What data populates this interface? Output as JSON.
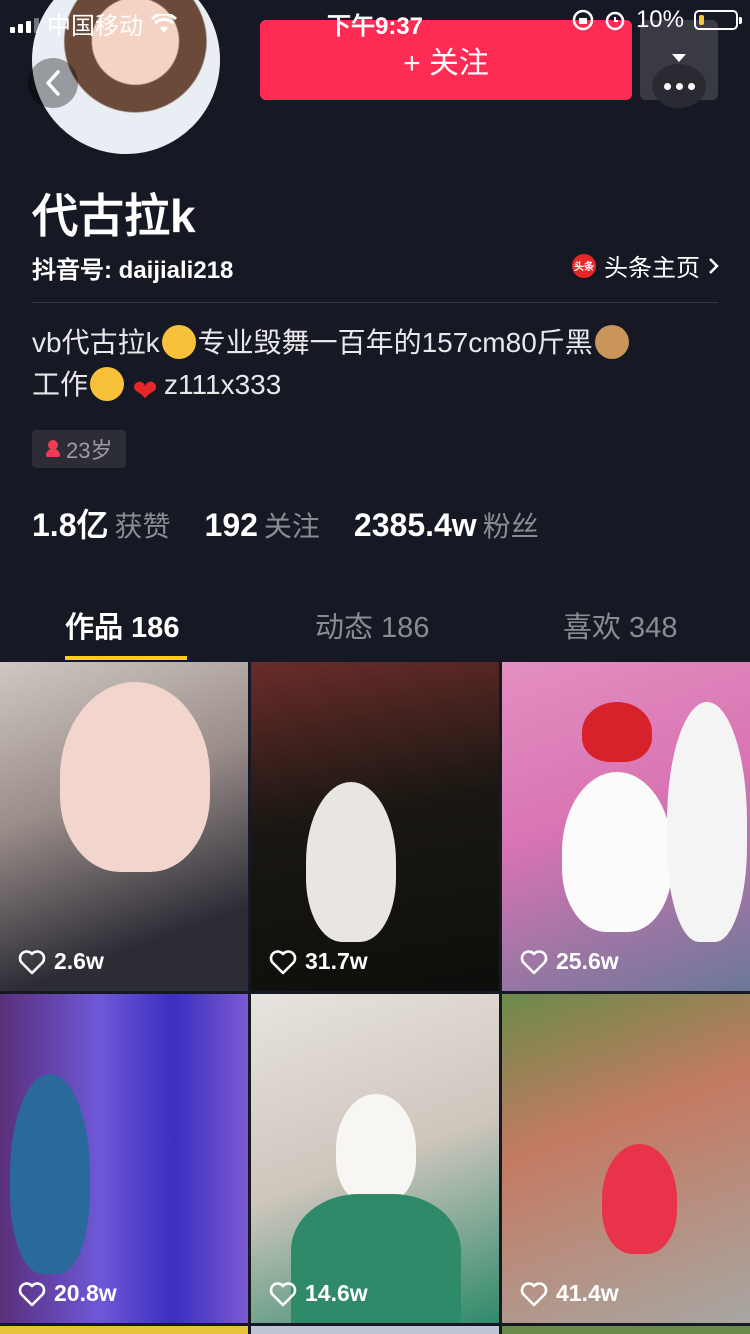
{
  "status_bar": {
    "carrier": "中国移动",
    "time": "下午9:37",
    "battery": "10%"
  },
  "header": {
    "follow_label": "+ 关注"
  },
  "profile": {
    "name": "代古拉k",
    "douyin_id": "抖音号: daijiali218",
    "toutiao_label": "头条主页",
    "toutiao_logo": "头条",
    "bio_part1": "vb代古拉k",
    "bio_part2": "专业毁舞一百年的157cm80斤黑",
    "bio_part3": "工作",
    "bio_part4": "z111x333",
    "age": "23岁"
  },
  "stats": [
    {
      "num": "1.8亿",
      "label": "获赞"
    },
    {
      "num": "192",
      "label": "关注"
    },
    {
      "num": "2385.4w",
      "label": "粉丝"
    }
  ],
  "tabs": [
    {
      "label": "作品 186",
      "active": true
    },
    {
      "label": "动态 186",
      "active": false
    },
    {
      "label": "喜欢 348",
      "active": false
    }
  ],
  "videos": [
    {
      "likes": "2.6w"
    },
    {
      "likes": "31.7w"
    },
    {
      "likes": "25.6w"
    },
    {
      "likes": "20.8w"
    },
    {
      "likes": "14.6w"
    },
    {
      "likes": "41.4w"
    }
  ],
  "colors": {
    "background": "#161823",
    "follow_button": "#fe2c55",
    "tab_underline": "#face15"
  }
}
